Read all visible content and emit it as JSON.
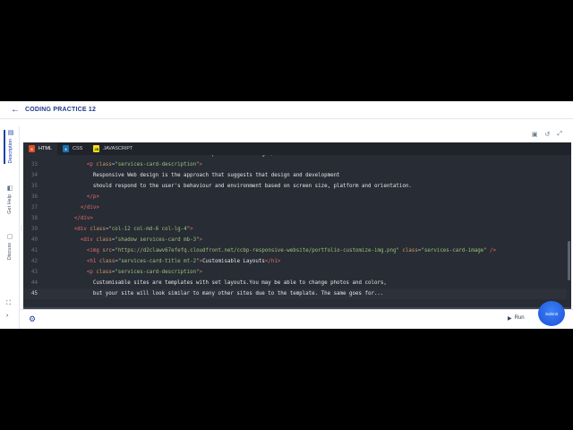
{
  "header": {
    "back_icon": "arrow-left-icon",
    "title": "CODING PRACTICE 12"
  },
  "sidebar": {
    "tabs": [
      {
        "label": "Description",
        "icon": "document-icon",
        "active": true
      },
      {
        "label": "Get Help",
        "icon": "help-icon",
        "active": false
      },
      {
        "label": "Discuss",
        "icon": "chat-icon",
        "active": false
      }
    ],
    "bottom_icons": [
      "expand-icon",
      "chevron-right-icon"
    ]
  },
  "toolbar": {
    "icons": [
      "save-icon",
      "reset-icon",
      "fullscreen-icon"
    ]
  },
  "editor": {
    "tabs": [
      {
        "label": "HTML",
        "badge": "5",
        "active": true
      },
      {
        "label": "CSS",
        "badge": "3",
        "active": false
      },
      {
        "label": "JAVASCRIPT",
        "badge": "JS",
        "active": false
      }
    ],
    "current_line": "45"
  },
  "footer": {
    "run_label": "Run",
    "submit_label": "Submit"
  },
  "colors": {
    "accent": "#1e40af",
    "editor_bg": "#282c34",
    "tag": "#e06c75",
    "attr": "#d19a66",
    "string": "#98c379"
  }
}
